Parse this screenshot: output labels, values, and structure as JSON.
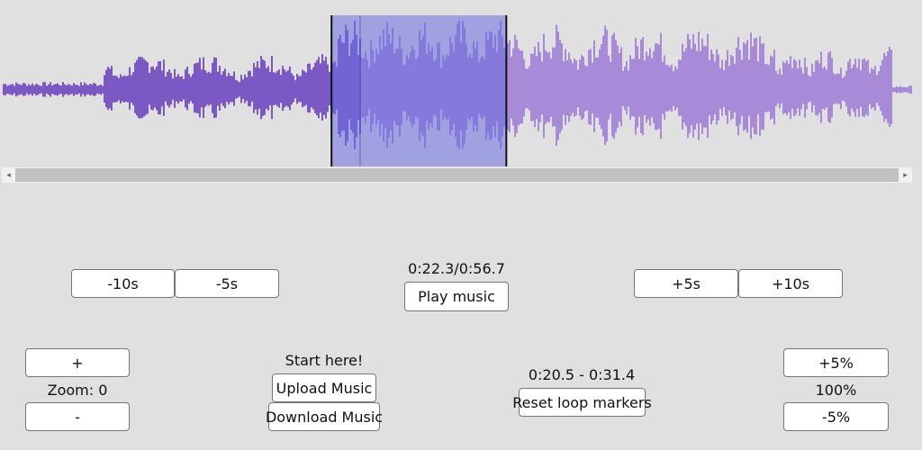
{
  "colors": {
    "background": "#e0e0e0",
    "wave_played": "#7b59c4",
    "wave_unplayed": "#a78bd8",
    "selection_fill": "#6a6ee0",
    "selection_border": "#111111"
  },
  "icons": {
    "scroll_left": "◂",
    "scroll_right": "▸"
  },
  "playback": {
    "time_display": "0:22.3/0:56.7",
    "play_label": "Play music",
    "progress_fraction": 0.393
  },
  "seek": {
    "back_10_label": "-10s",
    "back_5_label": "-5s",
    "fwd_5_label": "+5s",
    "fwd_10_label": "+10s"
  },
  "zoom": {
    "in_label": "+",
    "value_label": "Zoom: 0",
    "out_label": "-"
  },
  "file": {
    "hint": "Start here!",
    "upload_label": "Upload Music",
    "download_label": "Download Music"
  },
  "loop": {
    "range_label": "0:20.5 - 0:31.4",
    "reset_label": "Reset loop markers",
    "start_fraction": 0.3616,
    "end_fraction": 0.5538
  },
  "speed": {
    "up_label": "+5%",
    "value_label": "100%",
    "down_label": "-5%"
  }
}
